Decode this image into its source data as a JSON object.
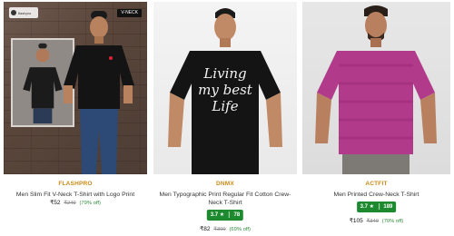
{
  "products": [
    {
      "brand": "FLASHPRO",
      "title": "Men Slim Fit V-Neck T-Shirt with Logo Print",
      "price": "₹52",
      "mrp": "₹249",
      "discount": "(79% off)",
      "image_logo_text": "flashpro",
      "image_tag": "V-NECK"
    },
    {
      "brand": "DNMX",
      "title": "Men Typographic Print Regular Fit Cotton Crew-Neck T-Shirt",
      "rating": "3.7",
      "rating_icon": "star-icon",
      "reviews": "78",
      "price": "₹82",
      "mrp": "₹300",
      "discount": "(69% off)",
      "shirt_print": [
        "Living",
        "my best",
        "Life"
      ]
    },
    {
      "brand": "ACTFIT",
      "title": "Men Printed Crew-Neck T-Shirt",
      "rating": "3.7",
      "rating_icon": "star-icon",
      "reviews": "189",
      "price": "₹105",
      "mrp": "₹349",
      "discount": "(70% off)"
    }
  ],
  "colors": {
    "brand": "#c98a14",
    "rating_bg": "#1e8a2f",
    "discount": "#2e8b3a",
    "shirt_black": "#1a1a1a",
    "shirt_magenta": "#b23a8a"
  }
}
